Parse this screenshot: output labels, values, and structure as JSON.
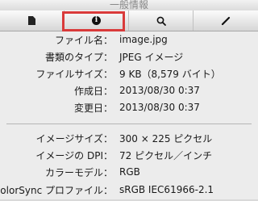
{
  "window": {
    "title": "一般情報"
  },
  "toolbar": {
    "tabs": [
      {
        "name": "general",
        "icon": "document-icon"
      },
      {
        "name": "info",
        "icon": "info-icon"
      },
      {
        "name": "inspector",
        "icon": "search-icon"
      },
      {
        "name": "annotation",
        "icon": "pen-icon"
      }
    ],
    "selected": "info",
    "highlight_color": "#d93a3a"
  },
  "file_info": [
    {
      "label": "ファイル名：",
      "value": "image.jpg"
    },
    {
      "label": "書類のタイプ：",
      "value": "JPEG イメージ"
    },
    {
      "label": "ファイルサイズ：",
      "value": "9 KB（8,579 バイト）"
    },
    {
      "label": "作成日：",
      "value": "2013/08/30 0:37"
    },
    {
      "label": "変更日：",
      "value": "2013/08/30 0:37"
    }
  ],
  "image_info": [
    {
      "label": "イメージサイズ：",
      "value": "300 × 225 ピクセル"
    },
    {
      "label": "イメージの DPI：",
      "value": "72 ピクセル／インチ"
    },
    {
      "label": "カラーモデル：",
      "value": "RGB"
    },
    {
      "label": "ColorSync プロファイル：",
      "value": "sRGB IEC61966-2.1"
    }
  ]
}
